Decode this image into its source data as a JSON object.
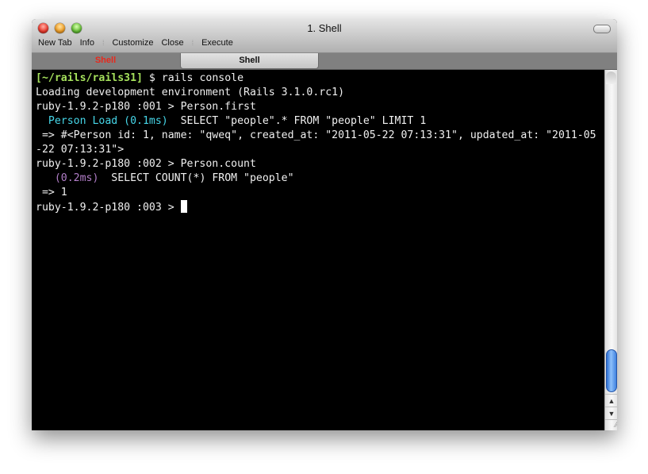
{
  "window": {
    "title": "1. Shell"
  },
  "toolbar": {
    "items": [
      {
        "label": "New Tab"
      },
      {
        "label": "Info"
      },
      {
        "label": "Customize"
      },
      {
        "label": "Close"
      },
      {
        "label": "Execute"
      }
    ]
  },
  "tabs": [
    {
      "label": "Shell",
      "color": "#e8281c",
      "active": false
    },
    {
      "label": "Shell",
      "active": true
    }
  ],
  "terminal": {
    "prompt_path": "[~/rails/rails31]",
    "prompt_cmd": " $ rails console",
    "line2": "Loading development environment (Rails 3.1.0.rc1)",
    "line3": "ruby-1.9.2-p180 :001 > Person.first",
    "line4_label": "  Person Load (0.1ms)",
    "line4_sql": "  SELECT \"people\".* FROM \"people\" LIMIT 1",
    "line5": " => #<Person id: 1, name: \"qweq\", created_at: \"2011-05-22 07:13:31\", updated_at: \"2011-05",
    "line6": "-22 07:13:31\">",
    "line7": "ruby-1.9.2-p180 :002 > Person.count",
    "line8_label": "   (0.2ms)",
    "line8_sql": "  SELECT COUNT(*) FROM \"people\"",
    "line9": " => 1",
    "line10": "ruby-1.9.2-p180 :003 > ",
    "colors": {
      "path": "#a5e05c",
      "load_label": "#46d6e8",
      "timing": "#b27ec8"
    }
  },
  "scrollbar": {
    "position_fraction": 1.0
  }
}
